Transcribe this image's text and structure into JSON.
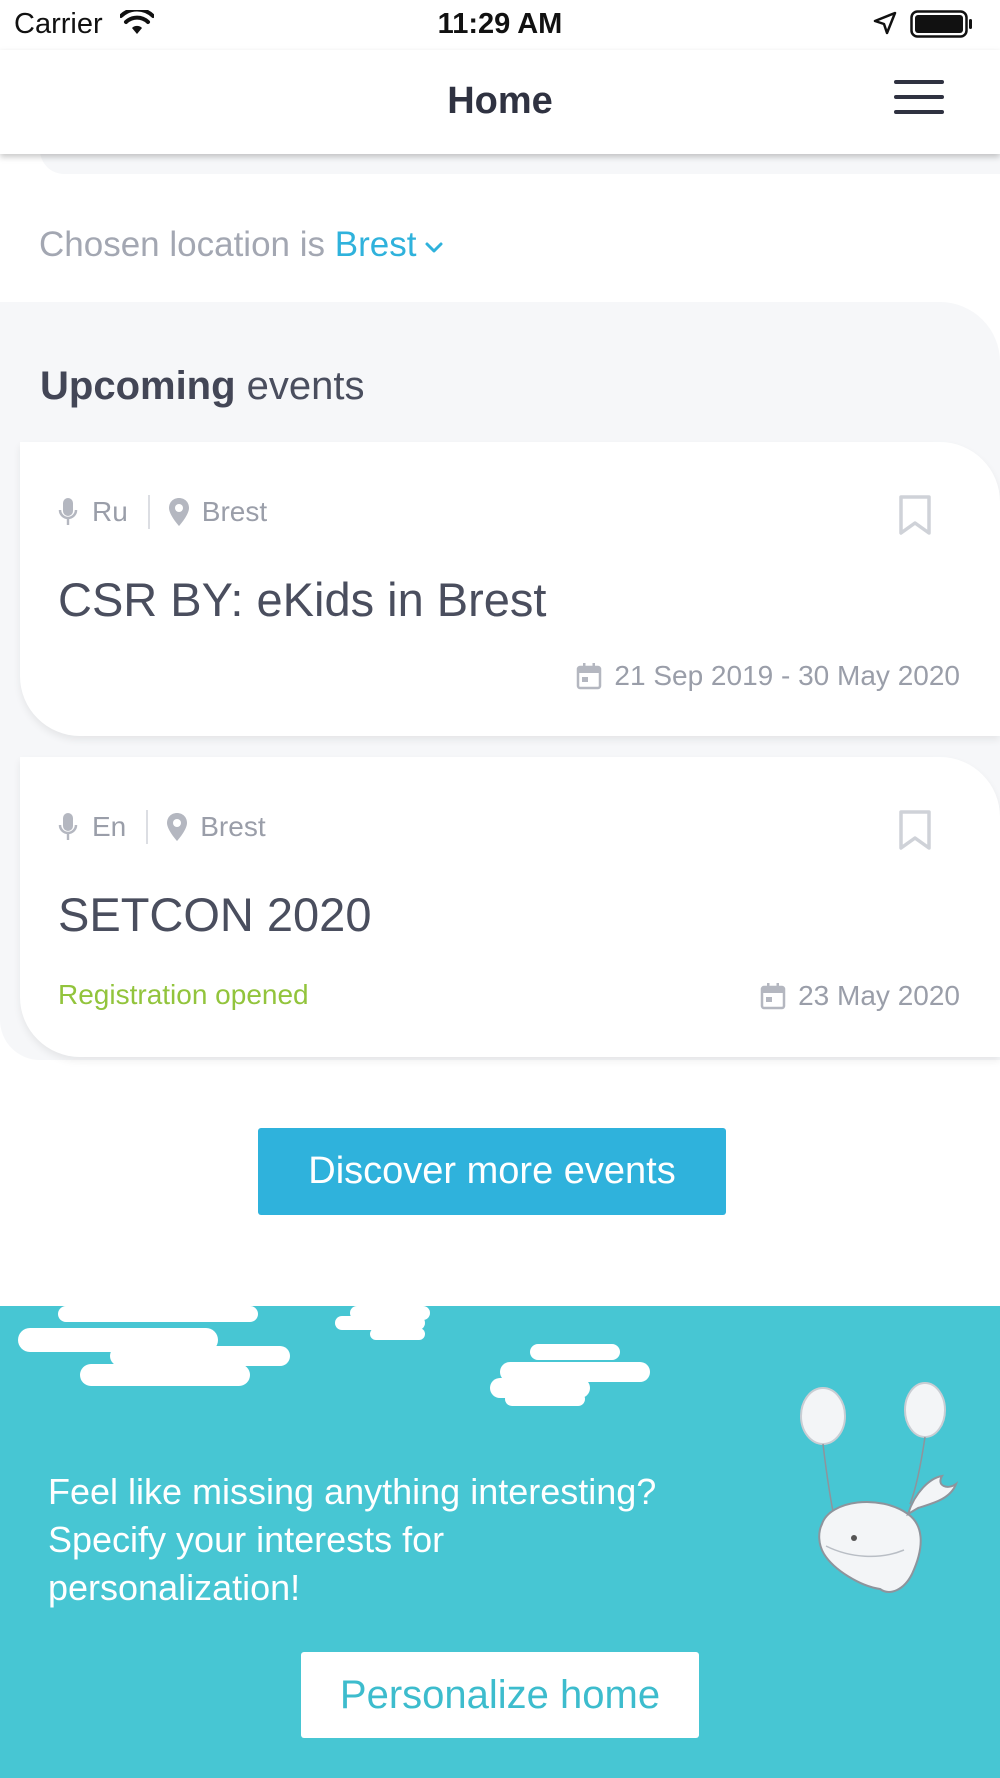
{
  "status_bar": {
    "carrier": "Carrier",
    "time": "11:29 AM"
  },
  "nav": {
    "title": "Home"
  },
  "location": {
    "prefix": "Chosen location is ",
    "city": "Brest"
  },
  "section": {
    "title_bold": "Upcoming",
    "title_rest": " events"
  },
  "events": [
    {
      "language": "Ru",
      "city": "Brest",
      "title": "CSR BY: eKids in Brest",
      "date": "21 Sep 2019 - 30 May 2020",
      "status": ""
    },
    {
      "language": "En",
      "city": "Brest",
      "title": "SETCON 2020",
      "date": "23 May 2020",
      "status": "Registration opened"
    }
  ],
  "discover_button": "Discover more events",
  "promo": {
    "text": "Feel like missing anything interesting? Specify your interests for personalization!",
    "button": "Personalize home"
  },
  "colors": {
    "accent": "#2fb2dc",
    "promo_bg": "#47c6d3",
    "status_green": "#92c43c",
    "text_dark": "#4a4e5e",
    "text_muted": "#9a9ea9"
  },
  "icons": [
    "wifi-icon",
    "location-arrow-icon",
    "battery-icon",
    "menu-icon",
    "chevron-down-icon",
    "microphone-icon",
    "map-pin-icon",
    "bookmark-icon",
    "calendar-icon",
    "whale-balloons-illustration"
  ]
}
